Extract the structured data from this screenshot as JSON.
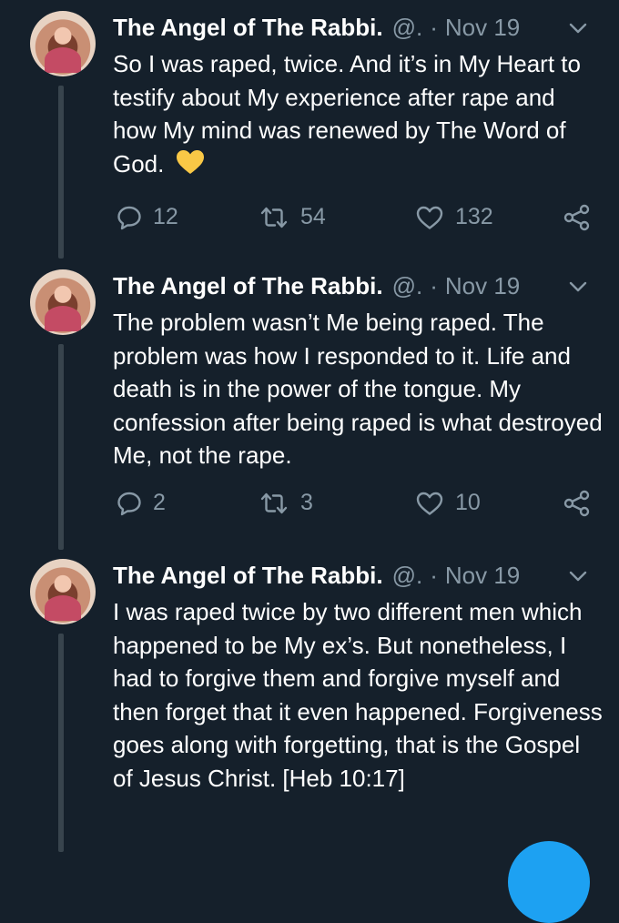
{
  "tweets": [
    {
      "name": "The Angel of The Rabbi.",
      "handle": "@.",
      "dot": "·",
      "date": "Nov 19",
      "text": "So I was raped, twice. And it’s in My Heart to testify about My experience after rape and how My mind was renewed by The Word of God.",
      "emoji": "💛",
      "replies": "12",
      "retweets": "54",
      "likes": "132"
    },
    {
      "name": "The Angel of The Rabbi.",
      "handle": "@.",
      "dot": "·",
      "date": "Nov 19",
      "text": "The problem wasn’t Me being raped. The problem was how I responded to it. Life and death is in the power of the tongue. My confession after being raped is what destroyed Me, not the rape.",
      "replies": "2",
      "retweets": "3",
      "likes": "10"
    },
    {
      "name": "The Angel of The Rabbi.",
      "handle": "@.",
      "dot": "·",
      "date": "Nov 19",
      "text": "I was raped twice by two different men which happened to be My ex’s. But nonetheless, I had to forgive them and forgive myself and then forget that it even happened. Forgiveness goes along with forgetting, that is the Gospel of Jesus Christ. [Heb 10:17]"
    }
  ],
  "colors": {
    "background": "#15202b",
    "secondary_text": "#8899a6",
    "thread_line": "#38444d",
    "accent": "#1da1f2"
  },
  "icons": [
    "chevron-down-icon",
    "reply-icon",
    "retweet-icon",
    "like-icon",
    "share-icon"
  ]
}
